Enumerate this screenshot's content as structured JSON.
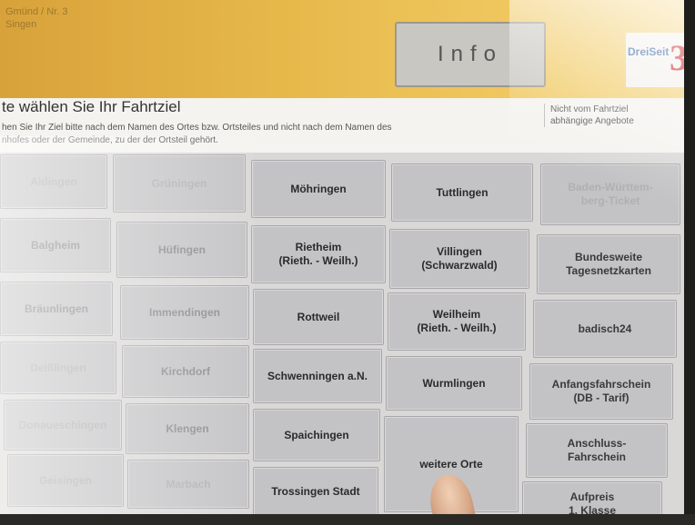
{
  "banner": {
    "top_left": "Gmünd / Nr. 3\nSingen",
    "info_label": "Info",
    "logo": "DreiSeit"
  },
  "header": {
    "title": "te wählen Sie Ihr Fahrtziel",
    "subtitle": "hen Sie Ihr Ziel bitte nach dem Namen des Ortes bzw. Ortsteiles und nicht nach dem Namen des\nnhofes oder der Gemeinde, zu der der Ortsteil gehört.",
    "side_header": "Nicht vom Fahrtziel\nabhängige Angebote"
  },
  "grid": {
    "col1": [
      "Aldingen",
      "Balgheim",
      "Bräunlingen",
      "Deißlingen",
      "Donaueschingen",
      "Geisingen"
    ],
    "col2": [
      "Grüningen",
      "Hüfingen",
      "Immendingen",
      "Kirchdorf",
      "Klengen",
      "Marbach"
    ],
    "col3": [
      "Möhringen",
      "Rietheim\n(Rieth. - Weilh.)",
      "Rottweil",
      "Schwenningen a.N.",
      "Spaichingen",
      "Trossingen Stadt"
    ],
    "col4": [
      "Tuttlingen",
      "Villingen\n(Schwarzwald)",
      "Weilheim\n(Rieth. - Weilh.)",
      "Wurmlingen",
      "weitere Orte"
    ],
    "side": [
      "Baden-Württem-\nberg-Ticket",
      "Bundesweite\nTagesnetzkarten",
      "badisch24",
      "Anfangsfahrschein\n(DB - Tarif)",
      "Anschluss-\nFahrschein",
      "Aufpreis\n1. Klasse"
    ]
  }
}
